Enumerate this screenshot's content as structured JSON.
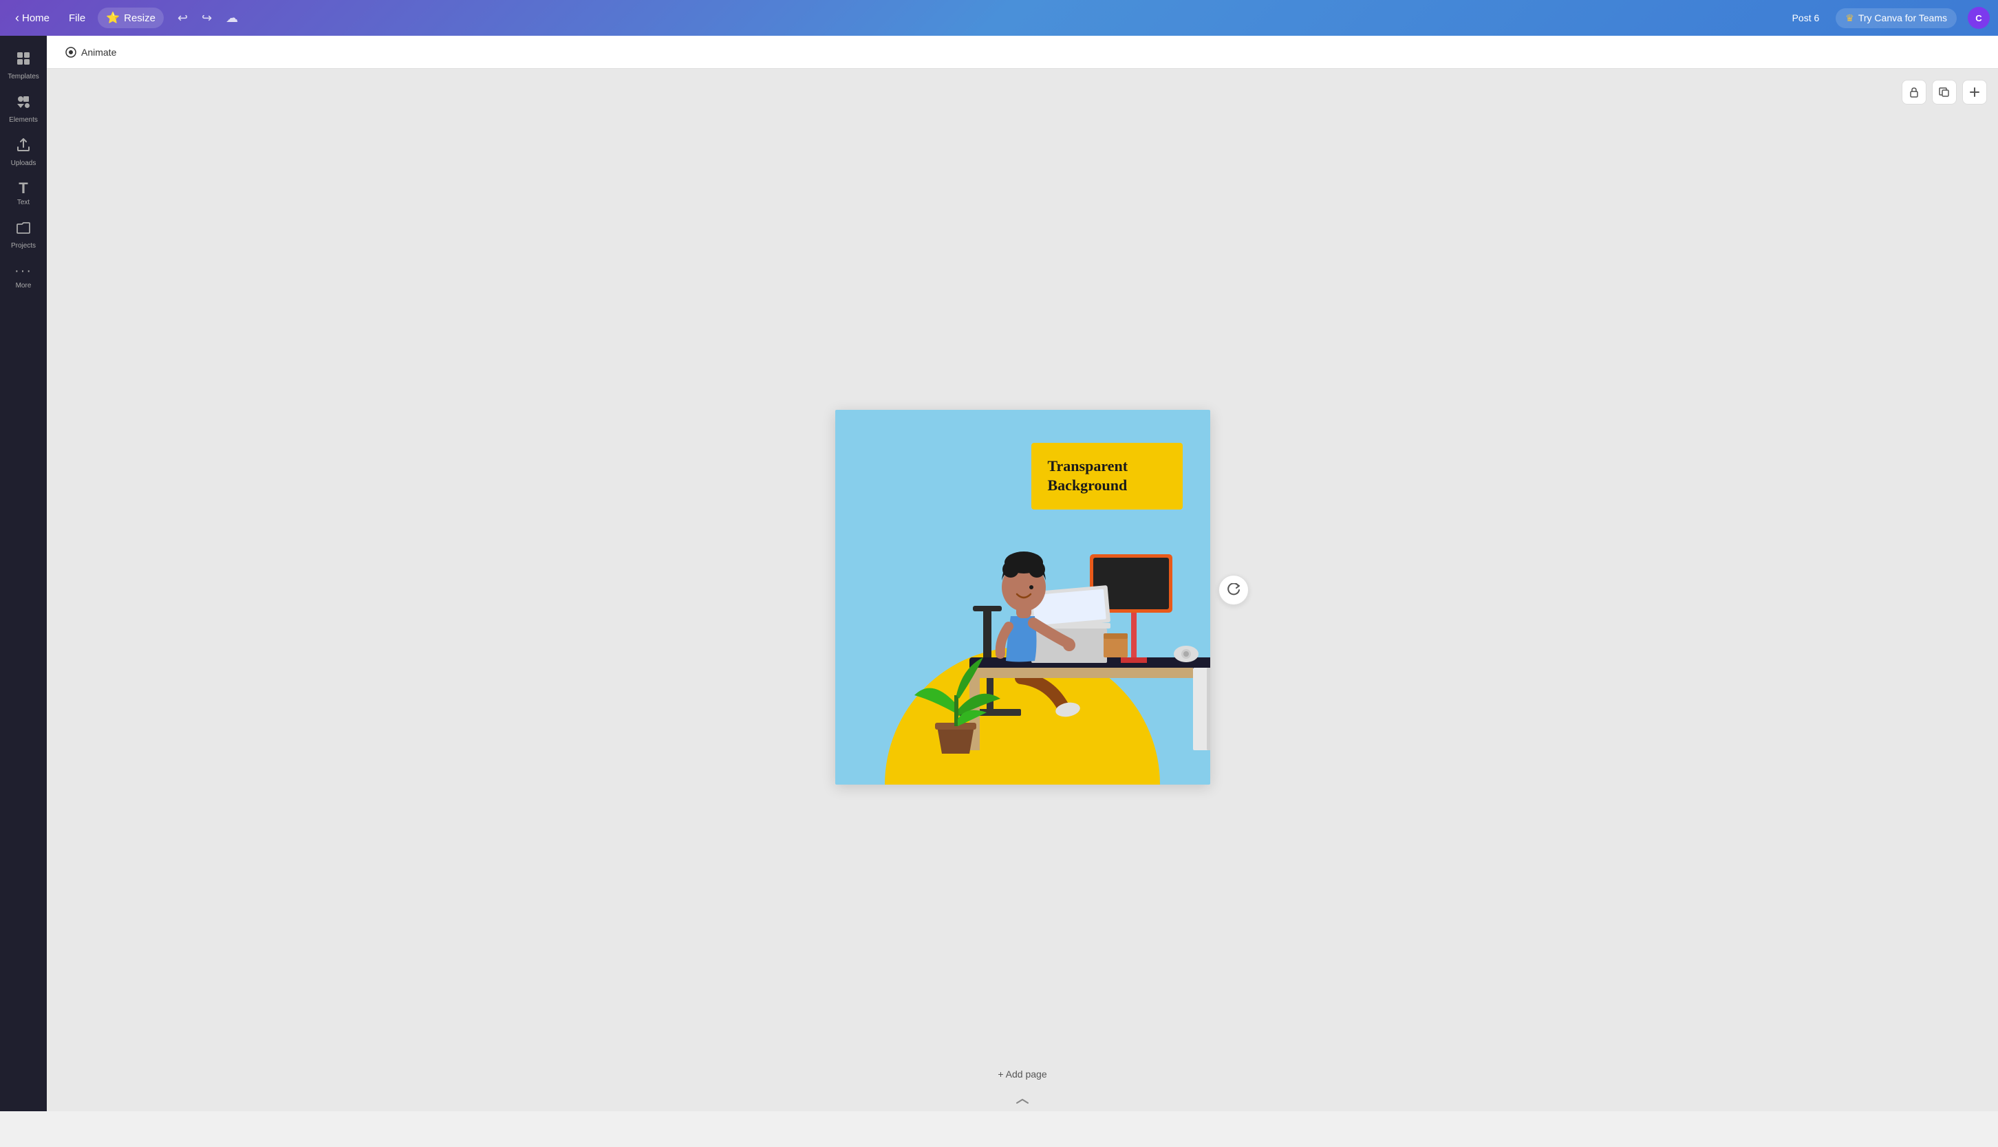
{
  "topnav": {
    "home_label": "Home",
    "file_label": "File",
    "resize_label": "Resize",
    "undo_icon": "↩",
    "redo_icon": "↪",
    "cloud_icon": "☁",
    "post_label": "Post 6",
    "try_canva_label": "Try Canva for Teams",
    "crown_icon": "♛",
    "avatar_label": "C",
    "chevron_left": "‹"
  },
  "toolbar": {
    "animate_label": "Animate",
    "animate_icon": "◎"
  },
  "sidebar": {
    "items": [
      {
        "label": "Templates",
        "icon": "⊞"
      },
      {
        "label": "Elements",
        "icon": "✦"
      },
      {
        "label": "Uploads",
        "icon": "⬆"
      },
      {
        "label": "Text",
        "icon": "T"
      },
      {
        "label": "Projects",
        "icon": "📁"
      },
      {
        "label": "More",
        "icon": "···"
      }
    ]
  },
  "canvas": {
    "lock_icon": "🔒",
    "copy_icon": "⧉",
    "add_icon": "+",
    "refresh_icon": "↻",
    "text_box": {
      "line1": "Transparent",
      "line2": "Background"
    },
    "add_page_label": "+ Add page"
  }
}
